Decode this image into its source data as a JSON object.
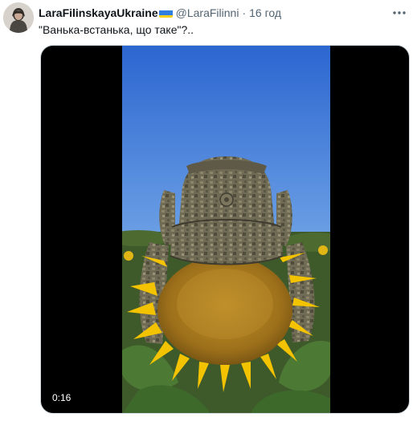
{
  "tweet": {
    "display_name": "LaraFilinskayaUkraine",
    "handle": "@LaraFilinni",
    "separator": "·",
    "time": "16 год",
    "text": "\"Ванька-встанька, що таке\"?..",
    "media": {
      "duration": "0:16"
    }
  },
  "icons": {
    "avatar": "profile-photo",
    "flag": "ukraine-flag-icon",
    "more": "more-dots-icon"
  },
  "colors": {
    "text": "#0f1419",
    "secondary_text": "#536471",
    "sky_top": "#2e6bd4",
    "sky_bottom": "#8fbbec",
    "petal": "#f5c400",
    "seed_head": "#a87a1e",
    "camo": "#6e6a52"
  }
}
